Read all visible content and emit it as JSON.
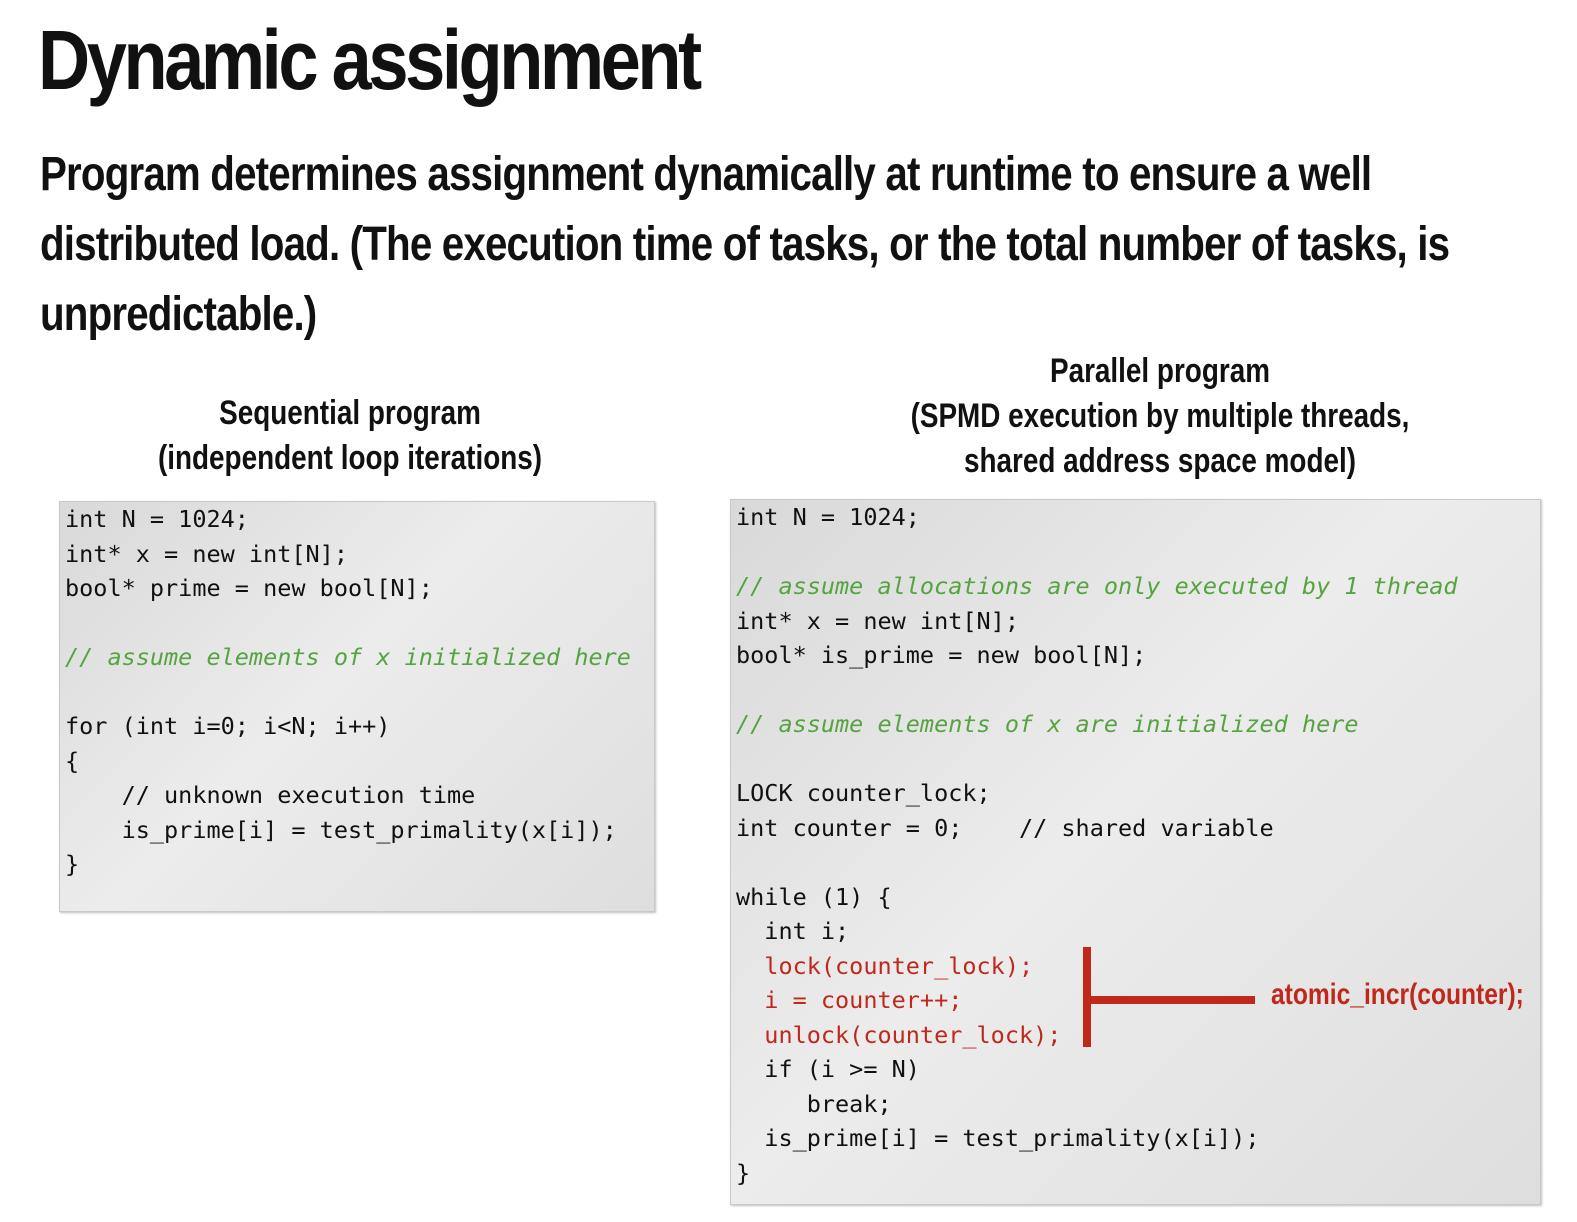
{
  "slide": {
    "title": "Dynamic assignment",
    "intro": "Program determines assignment dynamically at runtime to ensure a well distributed load.  (The execution time of tasks, or the total number of tasks, is unpredictable.)"
  },
  "left": {
    "caption_line1": "Sequential program",
    "caption_line2": "(independent loop iterations)",
    "code": [
      "int N = 1024;",
      "int* x = new int[N];",
      "bool* prime = new bool[N];",
      "",
      "// assume elements of x initialized here",
      "",
      "for (int i=0; i<N; i++)",
      "{",
      "    // unknown execution time",
      "    is_prime[i] = test_primality(x[i]);",
      "}"
    ]
  },
  "right": {
    "caption_line1": "Parallel program",
    "caption_line2": "(SPMD execution by multiple threads,",
    "caption_line3": "shared address space model)",
    "code": [
      "int N = 1024;",
      "",
      "// assume allocations are only executed by 1 thread",
      "int* x = new int[N];",
      "bool* is_prime = new bool[N];",
      "",
      "// assume elements of x are initialized here",
      "",
      "LOCK counter_lock;",
      "int counter = 0;    // shared variable",
      "",
      "while (1) {",
      "  int i;",
      "  lock(counter_lock);",
      "  i = counter++;",
      "  unlock(counter_lock);",
      "  if (i >= N)",
      "     break;",
      "  is_prime[i] = test_primality(x[i]);",
      "}"
    ],
    "annotation": "atomic_incr(counter);"
  },
  "colors": {
    "comment": "#56a441",
    "highlight": "#c0281c",
    "code_bg": "#e6e6e6"
  }
}
